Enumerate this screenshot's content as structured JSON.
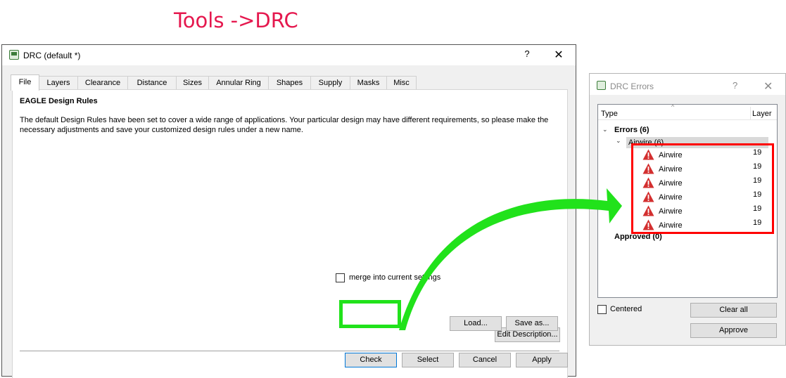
{
  "caption": "Tools ->DRC",
  "drc_dialog": {
    "title": "DRC (default *)",
    "help_glyph": "?",
    "close_glyph": "✕",
    "tabs": [
      {
        "label": "File",
        "active": true
      },
      {
        "label": "Layers"
      },
      {
        "label": "Clearance"
      },
      {
        "label": "Distance"
      },
      {
        "label": "Sizes"
      },
      {
        "label": "Annular Ring"
      },
      {
        "label": "Shapes"
      },
      {
        "label": "Supply"
      },
      {
        "label": "Masks"
      },
      {
        "label": "Misc"
      }
    ],
    "heading": "EAGLE Design Rules",
    "description": "The default Design Rules have been set to cover a wide range of applications. Your particular design may have different requirements, so please make the necessary adjustments and save your customized design rules under a new name.",
    "edit_description_label": "Edit Description...",
    "merge_label": "merge into current settings",
    "merge_checked": false,
    "load_label": "Load...",
    "save_as_label": "Save as...",
    "check_label": "Check",
    "select_label": "Select",
    "cancel_label": "Cancel",
    "apply_label": "Apply"
  },
  "errors_dialog": {
    "title": "DRC Errors",
    "help_glyph": "?",
    "close_glyph": "✕",
    "col_type": "Type",
    "col_layer": "Layer",
    "errors_group": "Errors (6)",
    "airwire_group": "Airwire (6)",
    "items": [
      {
        "name": "Airwire",
        "layer": "19"
      },
      {
        "name": "Airwire",
        "layer": "19"
      },
      {
        "name": "Airwire",
        "layer": "19"
      },
      {
        "name": "Airwire",
        "layer": "19"
      },
      {
        "name": "Airwire",
        "layer": "19"
      },
      {
        "name": "Airwire",
        "layer": "19"
      }
    ],
    "approved_group": "Approved (0)",
    "centered_label": "Centered",
    "centered_checked": false,
    "clear_all_label": "Clear all",
    "approve_label": "Approve"
  },
  "colors": {
    "caption": "#e5184e",
    "highlight_green": "#21e21b",
    "highlight_red": "#ff0000",
    "warning_red": "#d32f2f"
  }
}
